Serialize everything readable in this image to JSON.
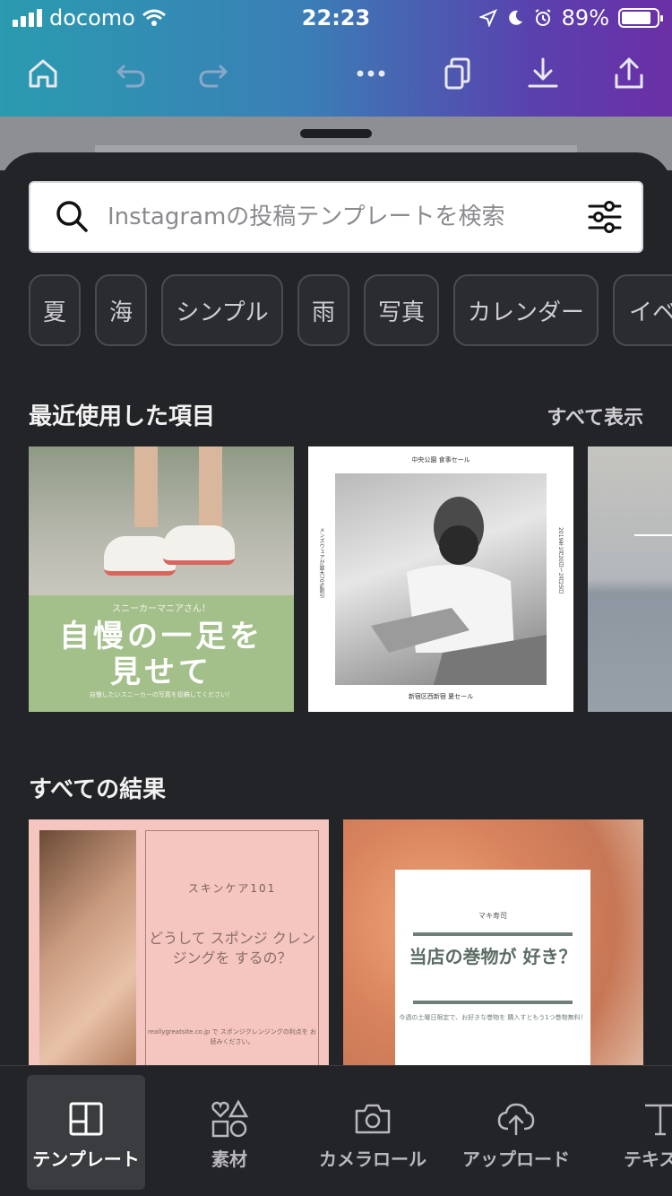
{
  "status_bar": {
    "carrier": "docomo",
    "time": "22:23",
    "battery_percent": "89%",
    "battery_level": 0.89
  },
  "toolbar": {
    "icons": [
      "home-icon",
      "undo-icon",
      "redo-icon",
      "more-icon",
      "copy-icon",
      "download-icon",
      "share-icon"
    ]
  },
  "search": {
    "placeholder": "Instagramの投稿テンプレートを検索"
  },
  "chips": [
    "夏",
    "海",
    "シンプル",
    "雨",
    "写真",
    "カレンダー",
    "イベ"
  ],
  "recent": {
    "title": "最近使用した項目",
    "see_all": "すべて表示",
    "items": [
      {
        "caption": "スニーカーマニアさん！",
        "headline_1": "自慢の一足を",
        "headline_2": "見せて",
        "subtext": "自慢したいスニーカーの写真を投稿してください！"
      },
      {
        "top_text": "中央公園 食事セール",
        "side_left": "メンズウェアが最大70%割引",
        "side_right": "2019年1月20日〜2月25日",
        "bottom_text": "新宿区西新宿 夏セール"
      },
      {}
    ]
  },
  "results": {
    "title": "すべての結果",
    "items": [
      {
        "heading": "スキンケア101",
        "body": "どうして スポンジ クレンジングを するの？",
        "footer": "reallygreatsite.co.jp で スポンジクレンジングの利点を お読みください。"
      },
      {
        "brand": "マキ寿司",
        "headline": "当店の巻物が 好き？",
        "desc": "今週の土曜日限定で、お好きな巻物を 購入すともう1つ巻物無料！"
      }
    ]
  },
  "bottom_nav": [
    {
      "label": "テンプレート",
      "icon": "template-icon",
      "active": true
    },
    {
      "label": "素材",
      "icon": "elements-icon",
      "active": false
    },
    {
      "label": "カメラロール",
      "icon": "camera-icon",
      "active": false
    },
    {
      "label": "アップロード",
      "icon": "upload-icon",
      "active": false
    },
    {
      "label": "テキスト",
      "icon": "text-icon",
      "active": false
    }
  ],
  "colors": {
    "header_gradient_start": "#2a9bb0",
    "header_gradient_end": "#6b2fa6",
    "sheet_background": "#232427",
    "chip_border": "#4a4b50"
  }
}
